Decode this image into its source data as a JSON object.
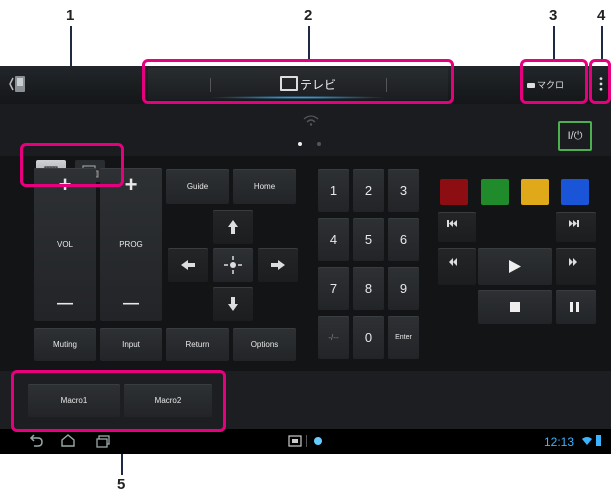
{
  "callouts": [
    "1",
    "2",
    "3",
    "4",
    "5"
  ],
  "header": {
    "title": "テレビ",
    "macro_indicator": "マクロ"
  },
  "power_label": "I/⏻",
  "pad": {
    "vol_label": "VOL",
    "prog_label": "PROG",
    "plus": "+",
    "minus": "—",
    "guide": "Guide",
    "home": "Home",
    "muting": "Muting",
    "input": "Input",
    "return": "Return",
    "options": "Options"
  },
  "numpad": {
    "keys": [
      "1",
      "2",
      "3",
      "4",
      "5",
      "6",
      "7",
      "8",
      "9",
      "-/--",
      "0",
      "Enter"
    ]
  },
  "colors": {
    "red": "#8c0e12",
    "green": "#1f8b2a",
    "yellow": "#e0a91a",
    "blue": "#1a55d8",
    "accent": "#3ab4ff",
    "power": "#4caf50",
    "highlight": "#e6007e"
  },
  "macros": [
    "Macro1",
    "Macro2"
  ],
  "status": {
    "clock": "12:13"
  }
}
